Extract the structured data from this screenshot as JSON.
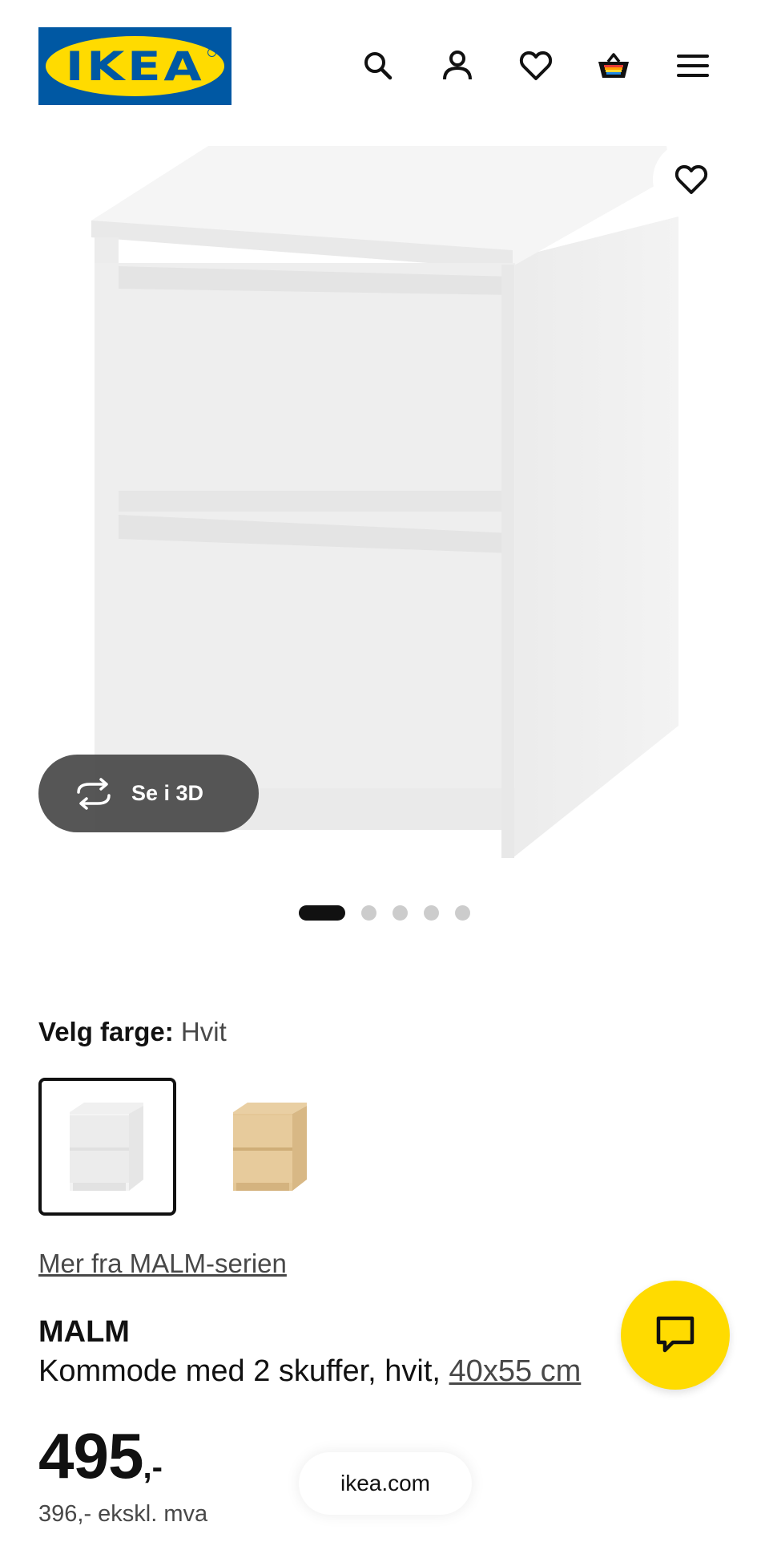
{
  "header": {
    "logo_text": "IKEA",
    "icons": [
      "search-icon",
      "account-icon",
      "heart-icon",
      "cart-icon",
      "menu-icon"
    ]
  },
  "gallery": {
    "see_3d_label": "Se i 3D",
    "slide_count": 5,
    "active_slide": 1
  },
  "color_select": {
    "label": "Velg farge:",
    "value": "Hvit",
    "options": [
      "Hvit",
      "Bjørk"
    ]
  },
  "series_link": "Mer fra MALM-serien",
  "product": {
    "name": "MALM",
    "description": "Kommode med 2 skuffer, hvit,",
    "size": "40x55 cm",
    "price": "495",
    "price_suffix": ",-",
    "price_ex_vat": "396,- ekskl. mva"
  },
  "browser": {
    "url": "ikea.com"
  },
  "colors": {
    "ikea_blue": "#0058a3",
    "ikea_yellow": "#ffdb00",
    "text": "#111111",
    "muted": "#484848"
  }
}
